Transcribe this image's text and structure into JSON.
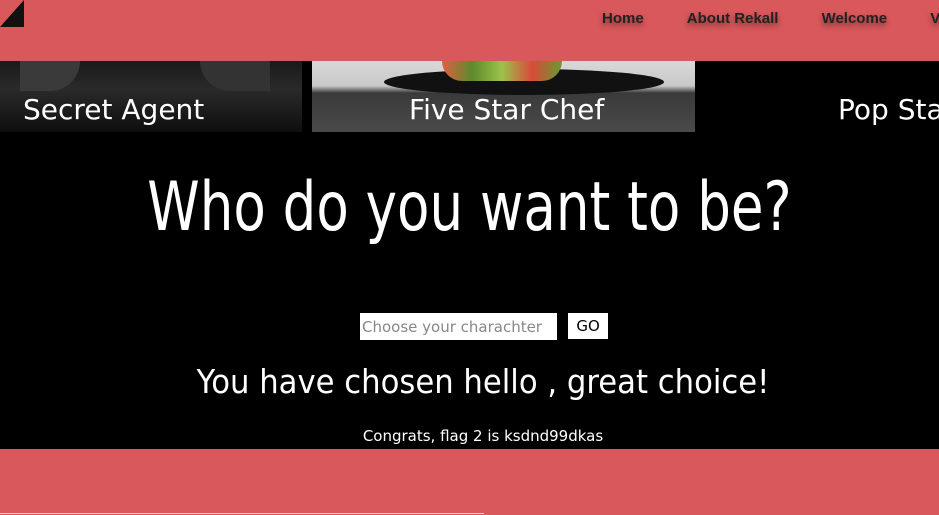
{
  "nav": {
    "items": [
      "Home",
      "About Rekall",
      "Welcome",
      "VR Planner"
    ]
  },
  "banner": {
    "cards": [
      {
        "label": "Secret Agent"
      },
      {
        "label": "Five Star Chef"
      },
      {
        "label": "Pop Star"
      }
    ]
  },
  "main": {
    "headline": "Who do you want to be?",
    "input_placeholder": "Choose your charachter",
    "input_value": "",
    "go_label": "GO",
    "chosen_message": "You have chosen hello , great choice!",
    "flag_message": "Congrats, flag 2 is ksdnd99dkas"
  },
  "colors": {
    "accent": "#d9585b",
    "background": "#000000",
    "text": "#ffffff"
  }
}
